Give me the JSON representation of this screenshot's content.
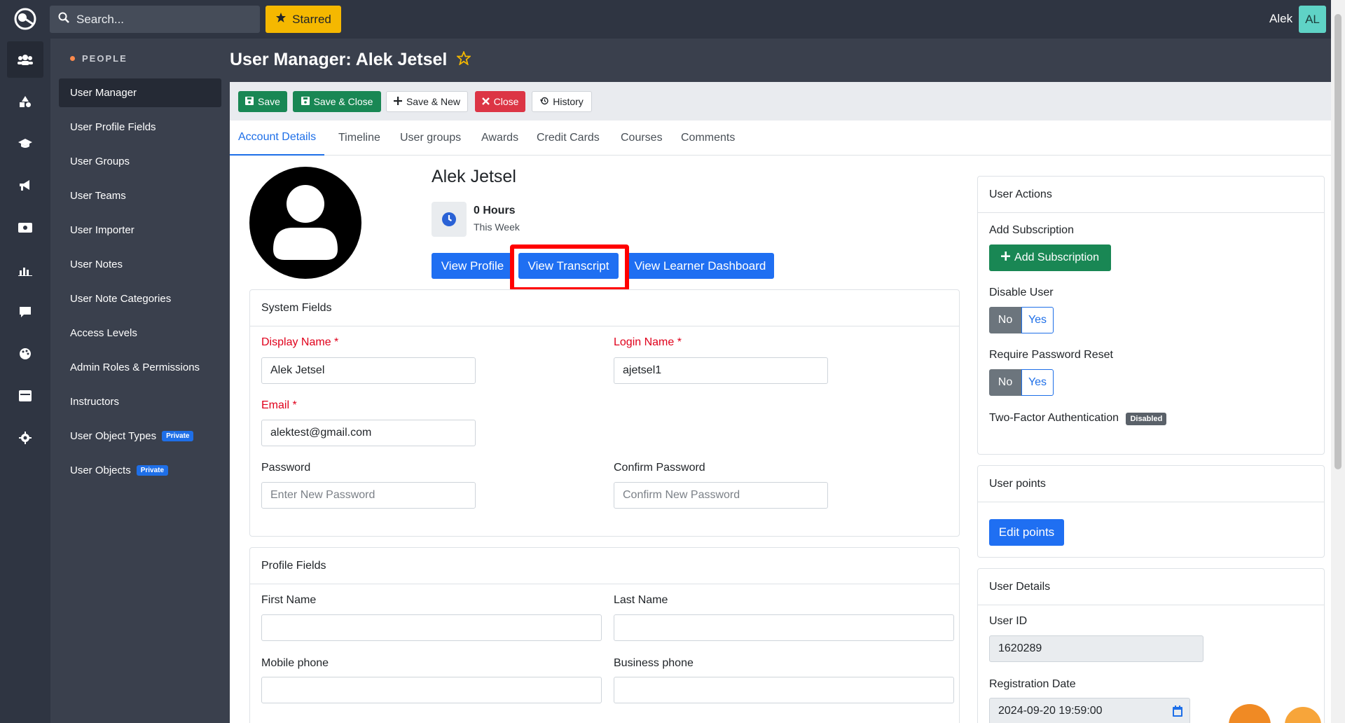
{
  "topbar": {
    "search_placeholder": "Search...",
    "starred_label": "Starred",
    "user_name": "Alek",
    "user_initials": "AL"
  },
  "sidebar": {
    "section_label": "PEOPLE",
    "items": [
      {
        "label": "User Manager"
      },
      {
        "label": "User Profile Fields"
      },
      {
        "label": "User Groups"
      },
      {
        "label": "User Teams"
      },
      {
        "label": "User Importer"
      },
      {
        "label": "User Notes"
      },
      {
        "label": "User Note Categories"
      },
      {
        "label": "Access Levels"
      },
      {
        "label": "Admin Roles & Permissions"
      },
      {
        "label": "Instructors"
      },
      {
        "label": "User Object Types",
        "badge": "Private"
      },
      {
        "label": "User Objects",
        "badge": "Private"
      }
    ]
  },
  "page": {
    "title": "User Manager: Alek Jetsel"
  },
  "toolbar": {
    "save": "Save",
    "save_close": "Save & Close",
    "save_new": "Save & New",
    "close": "Close",
    "history": "History"
  },
  "tabs": [
    "Account Details",
    "Timeline",
    "User groups",
    "Awards",
    "Credit Cards",
    "Courses",
    "Comments"
  ],
  "profile": {
    "name": "Alek Jetsel",
    "hours": "0 Hours",
    "period": "This Week",
    "view_profile": "View Profile",
    "view_transcript": "View Transcript",
    "view_dashboard": "View Learner Dashboard"
  },
  "system_fields": {
    "title": "System Fields",
    "display_name_label": "Display Name",
    "display_name_value": "Alek Jetsel",
    "login_name_label": "Login Name",
    "login_name_value": "ajetsel1",
    "email_label": "Email",
    "email_value": "alektest@gmail.com",
    "password_label": "Password",
    "password_placeholder": "Enter New Password",
    "confirm_label": "Confirm Password",
    "confirm_placeholder": "Confirm New Password",
    "required_mark": "*"
  },
  "profile_fields": {
    "title": "Profile Fields",
    "first_name": "First Name",
    "last_name": "Last Name",
    "mobile_phone": "Mobile phone",
    "business_phone": "Business phone"
  },
  "user_actions": {
    "title": "User Actions",
    "add_subscription_label": "Add Subscription",
    "add_subscription_button": "Add Subscription",
    "disable_user": "Disable User",
    "require_reset": "Require Password Reset",
    "no": "No",
    "yes": "Yes",
    "two_factor": "Two-Factor Authentication",
    "two_factor_badge": "Disabled"
  },
  "user_points": {
    "title": "User points",
    "edit_button": "Edit points"
  },
  "user_details": {
    "title": "User Details",
    "user_id_label": "User ID",
    "user_id_value": "1620289",
    "reg_date_label": "Registration Date",
    "reg_date_value": "2024-09-20 19:59:00"
  },
  "colors": {
    "topbar": "#2f3542",
    "sidebar": "#3a404d",
    "primary": "#1f6ff2",
    "success": "#198754",
    "danger": "#dc3545",
    "highlight": "#ff0000"
  }
}
